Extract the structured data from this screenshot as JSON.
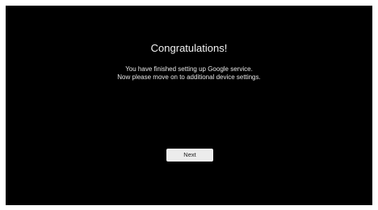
{
  "screen": {
    "title": "Congratulations!",
    "message_line_1": "You have finished setting up Google service.",
    "message_line_2": "Now please move on to additional device settings.",
    "next_label": "Next"
  },
  "colors": {
    "background": "#000000",
    "text": "#ffffff",
    "button_background": "#ececec",
    "button_text": "#202020"
  }
}
